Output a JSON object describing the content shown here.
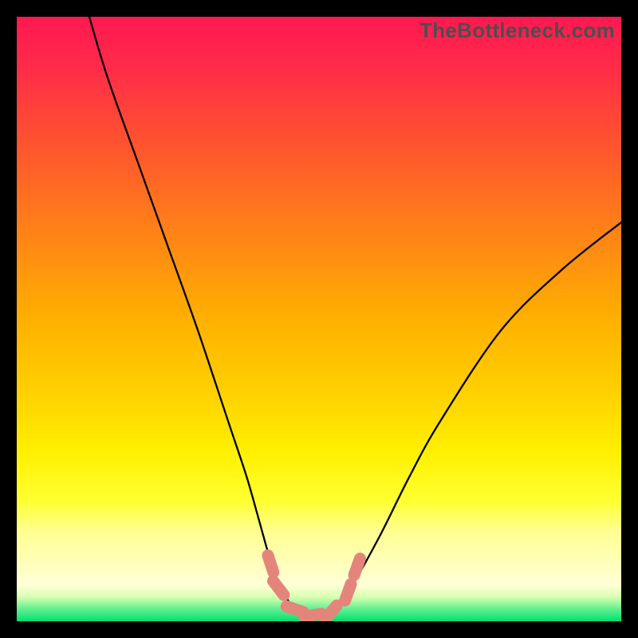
{
  "watermark": "TheBottleneck.com",
  "chart_data": {
    "type": "line",
    "title": "",
    "xlabel": "",
    "ylabel": "",
    "x_range": [
      0,
      100
    ],
    "y_range": [
      0,
      100
    ],
    "series": [
      {
        "name": "bottleneck-curve",
        "x": [
          12,
          15,
          20,
          25,
          30,
          35,
          38,
          40,
          42,
          44,
          46,
          48,
          50,
          53,
          55,
          60,
          65,
          70,
          80,
          90,
          100
        ],
        "y": [
          100,
          90,
          76,
          62,
          48,
          33,
          24,
          17,
          10,
          5,
          2,
          1,
          1,
          2,
          5,
          14,
          24,
          33,
          48,
          58,
          66
        ]
      }
    ],
    "markers": {
      "name": "highlight-segments",
      "color": "#e4857c",
      "points": [
        {
          "x": 42.0,
          "y": 9.5
        },
        {
          "x": 43.3,
          "y": 5.5
        },
        {
          "x": 46.0,
          "y": 2.0
        },
        {
          "x": 49.0,
          "y": 1.0
        },
        {
          "x": 52.0,
          "y": 1.5
        },
        {
          "x": 54.8,
          "y": 4.8
        },
        {
          "x": 56.3,
          "y": 9.0
        }
      ]
    }
  }
}
